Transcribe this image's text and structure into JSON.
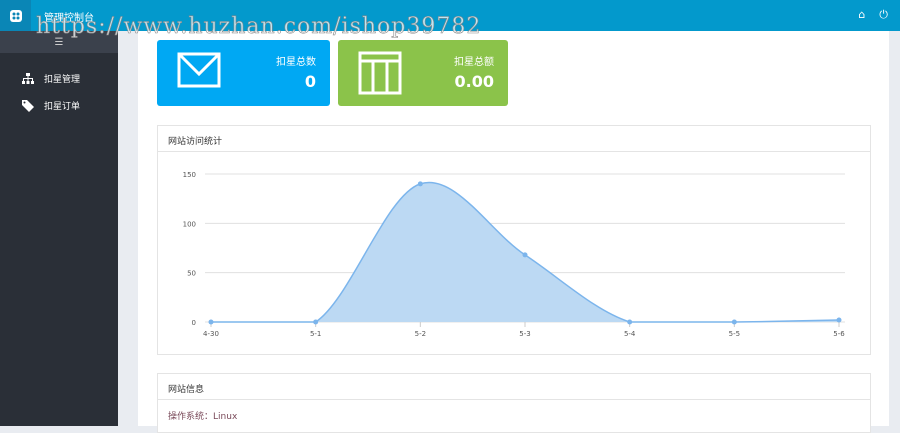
{
  "header": {
    "title": "管理控制台",
    "home_icon": "home-icon",
    "power_icon": "power-icon"
  },
  "sidebar": {
    "items": [
      {
        "label": "扣星管理",
        "icon": "sitemap-icon"
      },
      {
        "label": "扣星订单",
        "icon": "tag-icon"
      }
    ]
  },
  "cards": [
    {
      "label": "扣星总数",
      "value": "0",
      "color": "#00a8f3"
    },
    {
      "label": "扣星总额",
      "value": "0.00",
      "color": "#8bc34a"
    }
  ],
  "chart_panel": {
    "title": "网站访问统计"
  },
  "chart_data": {
    "type": "area",
    "categories": [
      "4-30",
      "5-1",
      "5-2",
      "5-3",
      "5-4",
      "5-5",
      "5-6"
    ],
    "values": [
      0,
      0,
      140,
      68,
      0,
      0,
      2
    ],
    "yticks": [
      "0",
      "50",
      "100",
      "150"
    ],
    "ylim": [
      0,
      150
    ],
    "grid": true,
    "color": "#7cb5ec"
  },
  "info_panel": {
    "title": "网站信息",
    "os_label": "操作系统：",
    "os_value": "Linux"
  },
  "watermark": "https://www.huzhan.com/ishop39782"
}
